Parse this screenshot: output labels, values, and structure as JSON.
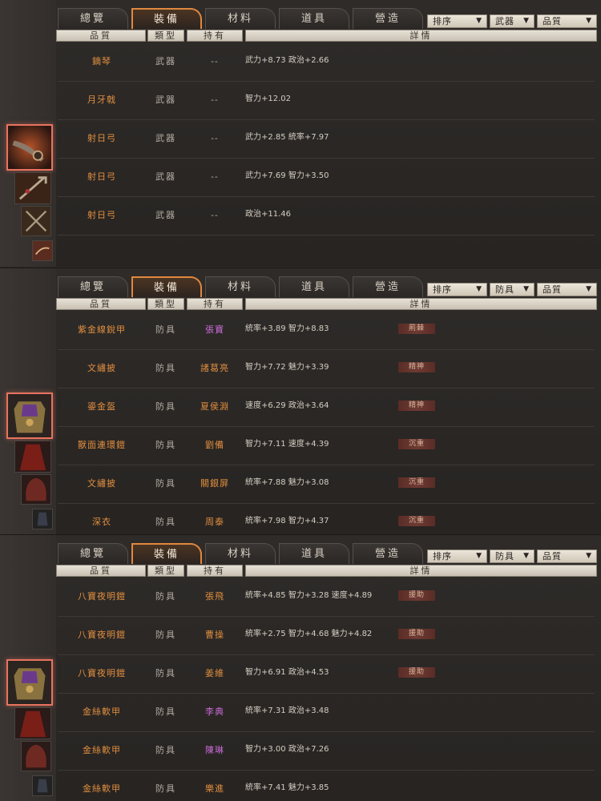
{
  "panels": [
    {
      "tabs": [
        "總覽",
        "裝備",
        "材料",
        "道具",
        "營造"
      ],
      "active_tab": 1,
      "filters": [
        "排序",
        "武器",
        "品質"
      ],
      "headers": [
        "品質",
        "類型",
        "持有",
        "詳情"
      ],
      "rows": [
        {
          "name": "鏑琴",
          "type": "武器",
          "owner": "--",
          "owner_color": "gray",
          "stats": "武力+8.73  政治+2.66",
          "badge": ""
        },
        {
          "name": "月牙戟",
          "type": "武器",
          "owner": "--",
          "owner_color": "gray",
          "stats": "智力+12.02",
          "badge": ""
        },
        {
          "name": "射日弓",
          "type": "武器",
          "owner": "--",
          "owner_color": "gray",
          "stats": "武力+2.85  統率+7.97",
          "badge": ""
        },
        {
          "name": "射日弓",
          "type": "武器",
          "owner": "--",
          "owner_color": "gray",
          "stats": "武力+7.69  智力+3.50",
          "badge": ""
        },
        {
          "name": "射日弓",
          "type": "武器",
          "owner": "--",
          "owner_color": "gray",
          "stats": "政治+11.46",
          "badge": ""
        }
      ]
    },
    {
      "tabs": [
        "總覽",
        "裝備",
        "材料",
        "道具",
        "營造"
      ],
      "active_tab": 1,
      "filters": [
        "排序",
        "防具",
        "品質"
      ],
      "headers": [
        "品質",
        "類型",
        "持有",
        "詳情"
      ],
      "rows": [
        {
          "name": "紫金線銳甲",
          "type": "防具",
          "owner": "張寶",
          "owner_color": "purple",
          "stats": "統率+3.89  智力+8.83",
          "badge": "荊棘"
        },
        {
          "name": "文繡披",
          "type": "防具",
          "owner": "諸葛亮",
          "owner_color": "orange",
          "stats": "智力+7.72  魅力+3.39",
          "badge": "精神"
        },
        {
          "name": "鎏金盔",
          "type": "防具",
          "owner": "夏侯淵",
          "owner_color": "orange",
          "stats": "速度+6.29  政治+3.64",
          "badge": "精神"
        },
        {
          "name": "獸面連環鎧",
          "type": "防具",
          "owner": "劉備",
          "owner_color": "orange",
          "stats": "智力+7.11  速度+4.39",
          "badge": "沉重"
        },
        {
          "name": "文繡披",
          "type": "防具",
          "owner": "關銀屏",
          "owner_color": "orange",
          "stats": "統率+7.88  魅力+3.08",
          "badge": "沉重"
        },
        {
          "name": "深衣",
          "type": "防具",
          "owner": "周泰",
          "owner_color": "orange",
          "stats": "統率+7.98  智力+4.37",
          "badge": "沉重"
        }
      ]
    },
    {
      "tabs": [
        "總覽",
        "裝備",
        "材料",
        "道具",
        "營造"
      ],
      "active_tab": 1,
      "filters": [
        "排序",
        "防具",
        "品質"
      ],
      "headers": [
        "品質",
        "類型",
        "持有",
        "詳情"
      ],
      "rows": [
        {
          "name": "八寶夜明鎧",
          "type": "防具",
          "owner": "張飛",
          "owner_color": "orange",
          "stats": "統率+4.85  智力+3.28  速度+4.89",
          "badge": "援助"
        },
        {
          "name": "八寶夜明鎧",
          "type": "防具",
          "owner": "曹操",
          "owner_color": "orange",
          "stats": "統率+2.75  智力+4.68  魅力+4.82",
          "badge": "援助"
        },
        {
          "name": "八寶夜明鎧",
          "type": "防具",
          "owner": "姜維",
          "owner_color": "orange",
          "stats": "智力+6.91  政治+4.53",
          "badge": "援助"
        },
        {
          "name": "金絲軟甲",
          "type": "防具",
          "owner": "李典",
          "owner_color": "purple",
          "stats": "統率+7.31  政治+3.48",
          "badge": ""
        },
        {
          "name": "金絲軟甲",
          "type": "防具",
          "owner": "陳琳",
          "owner_color": "purple",
          "stats": "智力+3.00  政治+7.26",
          "badge": ""
        },
        {
          "name": "金絲軟甲",
          "type": "防具",
          "owner": "樂進",
          "owner_color": "orange",
          "stats": "統率+7.41  魅力+3.85",
          "badge": ""
        }
      ]
    }
  ]
}
